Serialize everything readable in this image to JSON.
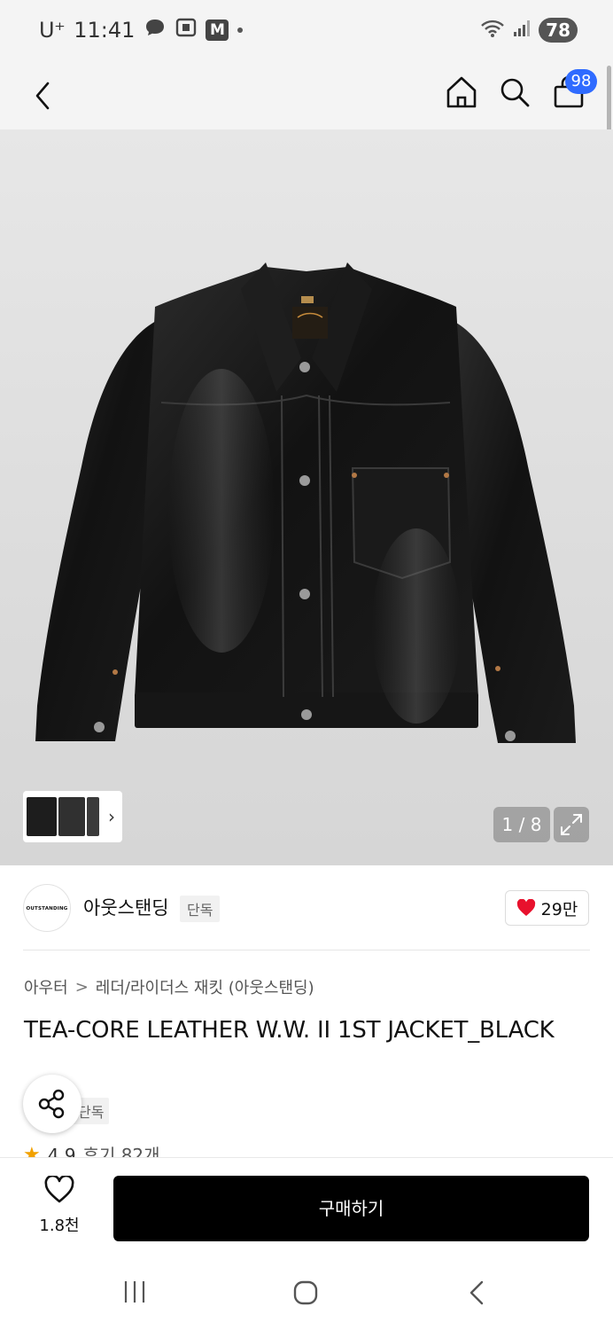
{
  "status_bar": {
    "carrier": "U⁺",
    "time": "11:41",
    "notification_m": "M",
    "battery": "78"
  },
  "header": {
    "cart_count": "98"
  },
  "gallery": {
    "page_counter": "1 / 8"
  },
  "brand": {
    "logo_text": "OUTSTANDING",
    "name": "아웃스탠딩",
    "tag": "단독",
    "like_count": "29만"
  },
  "product": {
    "breadcrumb": [
      "아우터",
      "레더/라이더스 재킷 (아웃스탠딩)"
    ],
    "breadcrumb_separator": ">",
    "title": "TEA-CORE LEATHER W.W. II 1ST JACKET_BLACK",
    "exclusive_tag": "단독",
    "rating": "4.9",
    "reviews": "후기 82개"
  },
  "action_bar": {
    "wish_count": "1.8천",
    "buy_label": "구매하기"
  },
  "colors": {
    "accent_badge": "#2f6bff",
    "buy_button": "#000000",
    "heart": "#e8112d",
    "star": "#f2a100"
  }
}
